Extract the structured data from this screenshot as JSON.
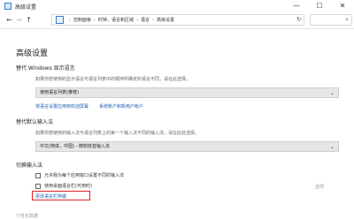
{
  "window": {
    "title": "高级设置",
    "controls": {
      "minimize": "—",
      "maximize": "☐",
      "close": "✕"
    }
  },
  "addressbar": {
    "nav": {
      "back": "←",
      "forward": "→",
      "up": "↑"
    },
    "breadcrumbs": [
      "控制面板",
      "时钟、语言和区域",
      "语言",
      "高级设置"
    ],
    "separator": "›",
    "refresh": "↻",
    "search_icon": "⌕"
  },
  "main": {
    "heading": "高级设置",
    "display_language": {
      "title": "替代 Windows 显示语言",
      "description": "如果你想使用的显示语言与语言列表中的顺序所确定的语言不同，请在此选择。",
      "select_value": "使用语言列表(推荐)",
      "links": [
        "将语言设置应用到欢迎屏幕",
        "系统账户和新用户帐户"
      ]
    },
    "input_method": {
      "title": "替代默认输入法",
      "description": "如果你想使用的输入法与语言列表上的第一个输入法不同的输入法，请在此处选择。",
      "select_value": "中文(简体，中国) - 微软拼音输入法"
    },
    "switch_input": {
      "title": "切换输入法",
      "checkbox1": "允许我为每个应用窗口设置不同的输入法",
      "checkbox2": "使用桌面语言栏(可用时)",
      "options_link": "选项",
      "hotkeys_link": "更改语言栏热键"
    },
    "footer": "个性化数据"
  },
  "colors": {
    "link": "#1f5fb2",
    "highlight": "#e02020"
  }
}
